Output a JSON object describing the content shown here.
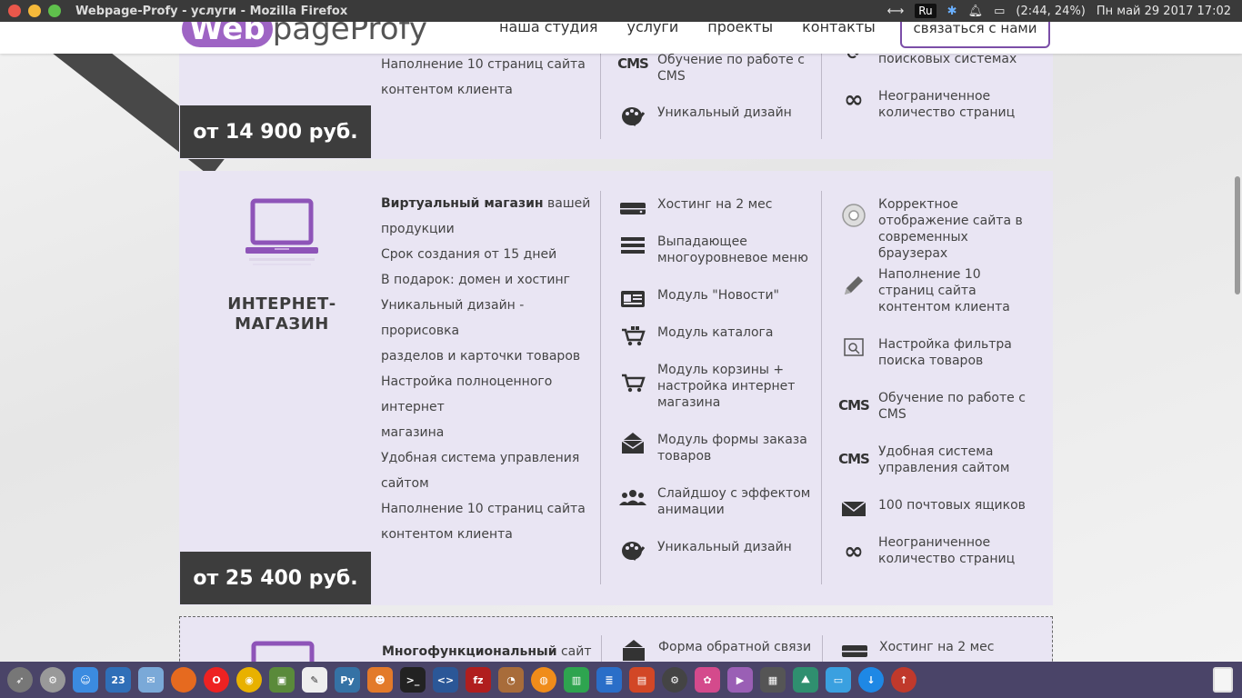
{
  "window": {
    "title": "Webpage-Profy - услуги - Mozilla Firefox",
    "lang": "Ru",
    "battery": "(2:44, 24%)",
    "clock": "Пн май 29 2017 17:02"
  },
  "header": {
    "logo_web": "Web",
    "logo_rest": "pageProfy",
    "nav": [
      "наша студия",
      "услуги",
      "проекты",
      "контакты"
    ],
    "contact_button": "связаться с нами"
  },
  "card1": {
    "desc_lines": [
      "Наполнение 10 страниц сайта",
      "контентом клиента"
    ],
    "price": "от 14 900 руб.",
    "col_mid": [
      {
        "icon": "cms-icon",
        "text": "Обучение по работе с CMS"
      },
      {
        "icon": "palette-icon",
        "text": "Уникальный дизайн"
      }
    ],
    "col_right": [
      {
        "icon": "search-engine-icon",
        "text": "поисковых системах"
      },
      {
        "icon": "infinity-icon",
        "text": "Неограниченное количество страниц"
      }
    ]
  },
  "card2": {
    "title_line1": "ИНТЕРНЕТ-",
    "title_line2": "МАГАЗИН",
    "desc_bold": "Виртуальный магазин",
    "desc_first_rest": " вашей",
    "desc_lines": [
      "продукции",
      "Срок создания от 15 дней",
      "В подарок: домен и хостинг",
      "Уникальный дизайн - прорисовка",
      "разделов и карточки товаров",
      "Настройка полноценного интернет",
      "магазина",
      "Удобная система управления",
      "сайтом",
      "Наполнение 10 страниц сайта",
      "контентом клиента"
    ],
    "price": "от 25 400 руб.",
    "col_mid": [
      {
        "icon": "server-icon",
        "text": "Хостинг на 2 мес"
      },
      {
        "icon": "menu-icon",
        "text": "Выпадающее многоуровневое меню"
      },
      {
        "icon": "news-icon",
        "text": "Модуль \"Новости\""
      },
      {
        "icon": "catalog-icon",
        "text": "Модуль каталога"
      },
      {
        "icon": "cart-icon",
        "text": "Модуль корзины + настройка интернет магазина"
      },
      {
        "icon": "mail-form-icon",
        "text": "Модуль формы заказа товаров"
      },
      {
        "icon": "slideshow-icon",
        "text": "Слайдшоу с эффектом анимации"
      },
      {
        "icon": "palette-icon",
        "text": "Уникальный дизайн"
      }
    ],
    "col_right": [
      {
        "icon": "browser-icon",
        "text": "Корректное отображение сайта в современных браузерах"
      },
      {
        "icon": "pencil-icon",
        "text": "Наполнение 10 страниц сайта контентом клиента"
      },
      {
        "icon": "filter-search-icon",
        "text": "Настройка фильтра поиска товаров"
      },
      {
        "icon": "cms-icon",
        "text": "Обучение по работе с CMS"
      },
      {
        "icon": "cms-icon",
        "text": "Удобная система управления сайтом"
      },
      {
        "icon": "mail-icon",
        "text": "100 почтовых ящиков"
      },
      {
        "icon": "infinity-icon",
        "text": "Неограниченное количество страниц"
      }
    ]
  },
  "card3": {
    "desc_bold": "Многофункциональный",
    "desc_rest": " сайт или",
    "col_mid": [
      {
        "icon": "mail-form-icon",
        "text": "Форма обратной связи"
      }
    ],
    "col_right": [
      {
        "icon": "server-icon",
        "text": "Хостинг на 2 мес"
      }
    ]
  },
  "dock": {
    "items": [
      "launcher",
      "settings",
      "finder",
      "calendar",
      "mail",
      "firefox",
      "opera",
      "chrome",
      "photos",
      "notes",
      "python",
      "cat",
      "terminal",
      "code",
      "filezilla",
      "gimp",
      "blender",
      "charts",
      "docs",
      "presentation",
      "system",
      "settings2",
      "media",
      "calculator",
      "monitor",
      "folder",
      "download",
      "upload",
      "trash"
    ],
    "calendar_day": "23"
  }
}
